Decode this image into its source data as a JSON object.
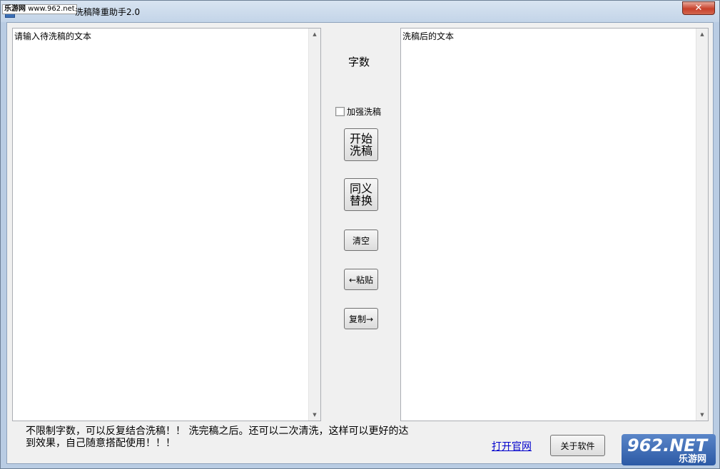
{
  "window": {
    "title": "洗稿降重助手2.0",
    "close_label": "✕"
  },
  "watermark": {
    "top_left_name": "乐游网",
    "top_left_url": "www.962.net",
    "bottom_right_big": "962.NET",
    "bottom_right_small": "乐游网"
  },
  "left_panel": {
    "text": "请输入待洗稿的文本"
  },
  "right_panel": {
    "text": "洗稿后的文本"
  },
  "middle": {
    "word_count_label": "字数",
    "strengthen_checkbox_label": "加强洗稿",
    "strengthen_checked": false,
    "start_button_line1": "开始",
    "start_button_line2": "洗稿",
    "synonym_button_line1": "同义",
    "synonym_button_line2": "替换",
    "clear_button": "清空",
    "paste_button": "←粘贴",
    "copy_button": "复制→"
  },
  "footer": {
    "note_line1": "不限制字数，可以反复结合洗稿！！ 洗完稿之后。还可以二次清洗，这样可以更好的达",
    "note_line2": "到效果，自己随意搭配使用！！！",
    "official_site_link": "打开官网",
    "about_button": "关于软件"
  },
  "icons": {
    "scroll_up": "▲",
    "scroll_down": "▼"
  }
}
